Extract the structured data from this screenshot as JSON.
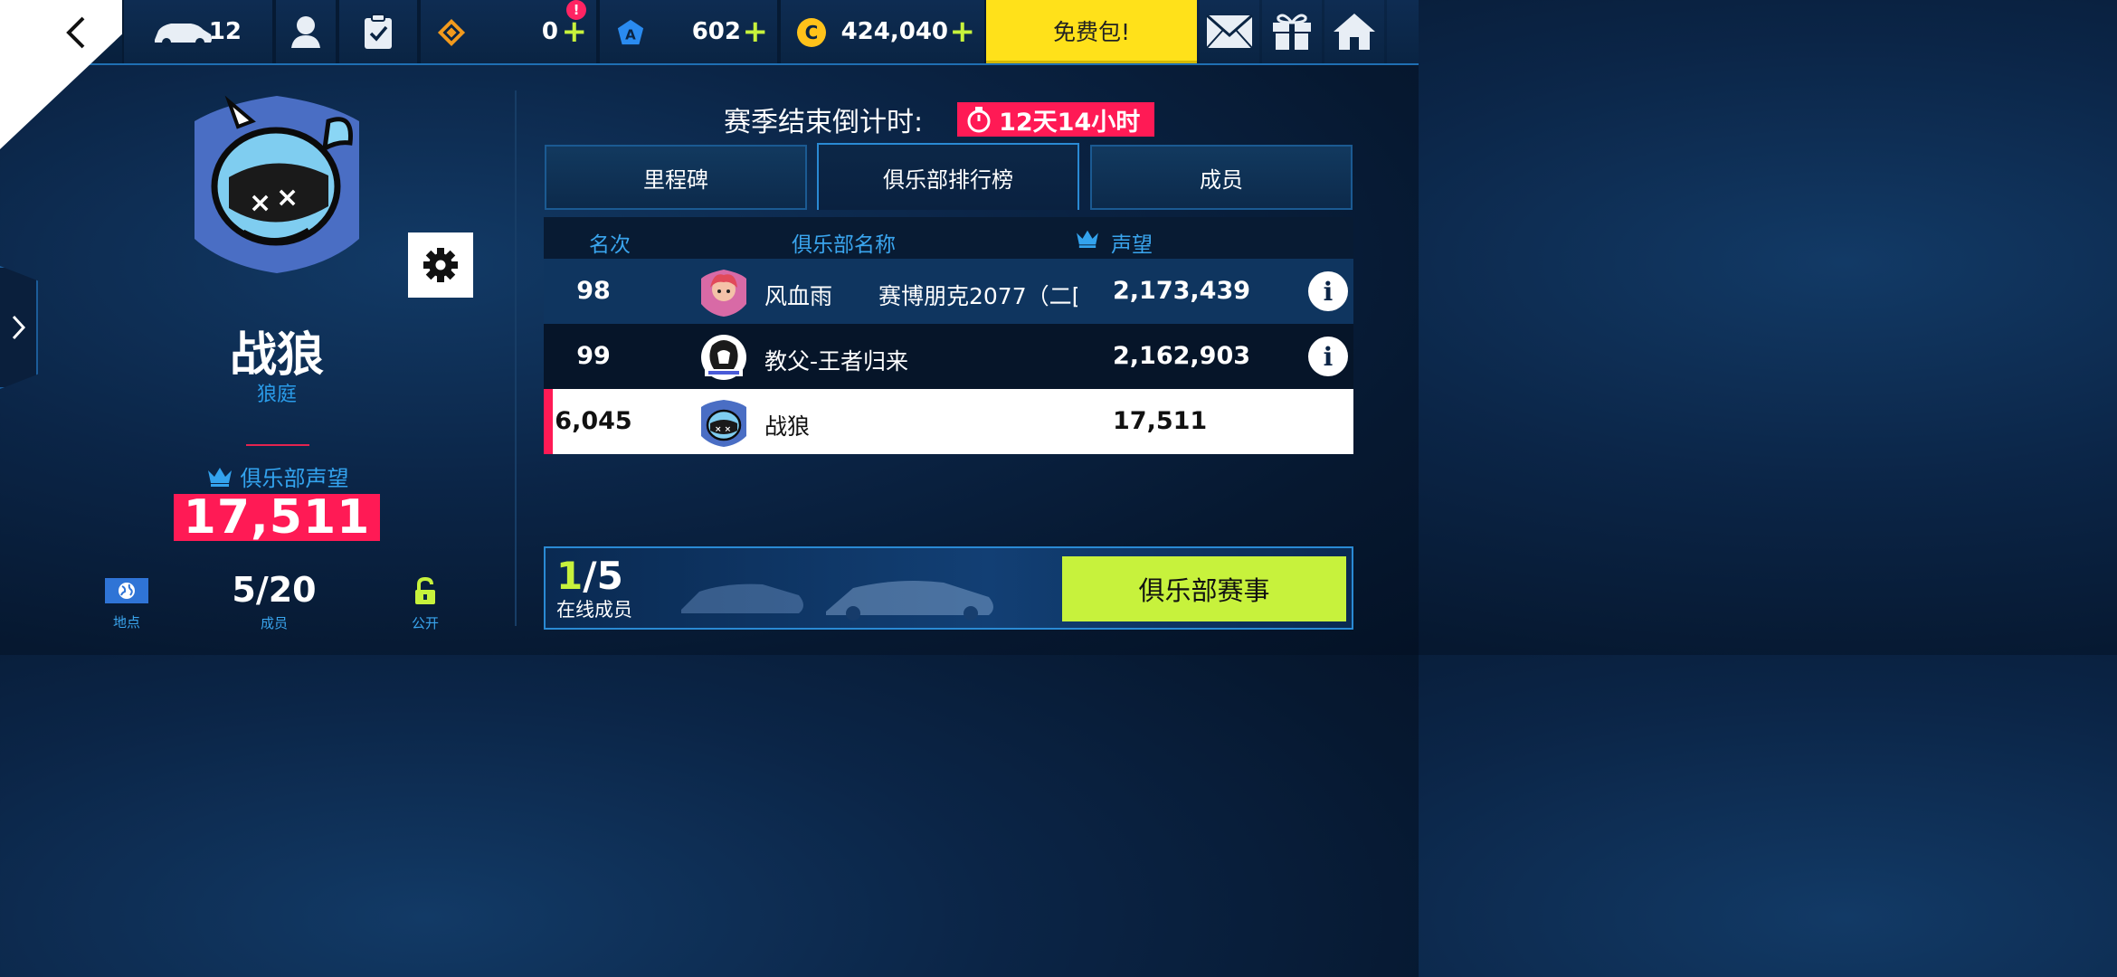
{
  "topbar": {
    "car_count": "12",
    "currency1": {
      "value": "0",
      "plus": "+",
      "alert": "!"
    },
    "currency2": {
      "value": "602",
      "plus": "+"
    },
    "currency3": {
      "value": "424,040",
      "plus": "+"
    },
    "free_pack": "免费包!"
  },
  "club": {
    "name": "战狼",
    "subtitle": "狼庭",
    "prestige_label": "俱乐部声望",
    "prestige_value": "17,511",
    "location_label": "地点",
    "members_value": "5/20",
    "members_label": "成员",
    "privacy_label": "公开"
  },
  "season": {
    "countdown_label": "赛季结束倒计时:",
    "countdown_value": "12天14小时"
  },
  "tabs": [
    {
      "label": "里程碑"
    },
    {
      "label": "俱乐部排行榜"
    },
    {
      "label": "成员"
    }
  ],
  "leaderboard": {
    "headers": {
      "rank": "名次",
      "club_name": "俱乐部名称",
      "prestige": "声望"
    },
    "rows": [
      {
        "rank": "98",
        "name": "风血雨",
        "name_extra": "赛博朋克2077（二[",
        "score": "2,173,439"
      },
      {
        "rank": "99",
        "name": "教父-王者归来",
        "name_extra": "",
        "score": "2,162,903"
      },
      {
        "rank": "6,045",
        "name": "战狼",
        "name_extra": "",
        "score": "17,511"
      }
    ]
  },
  "bottom": {
    "online_current": "1",
    "online_total": "/5",
    "online_label": "在线成员",
    "event_button": "俱乐部赛事"
  },
  "colors": {
    "accent_red": "#ff1a55",
    "accent_lime": "#c7f23c",
    "accent_blue": "#2a8ad4",
    "free_pack_yellow": "#ffe11a"
  }
}
